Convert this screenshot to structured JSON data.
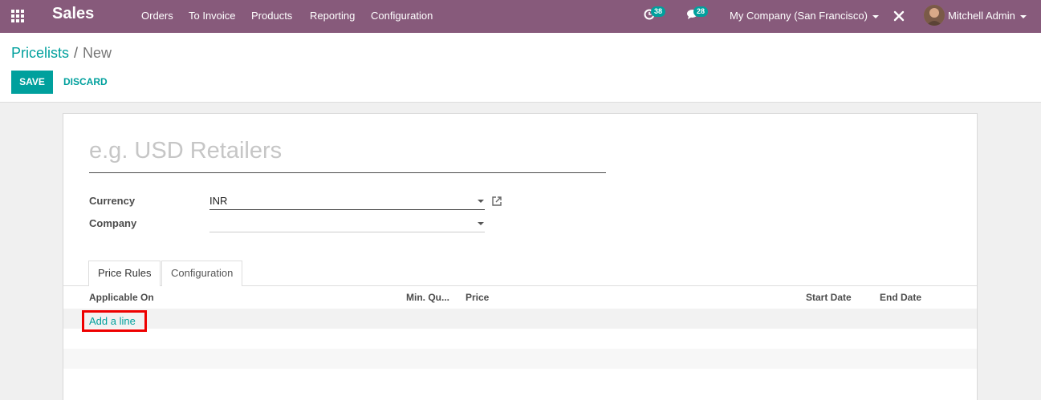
{
  "navbar": {
    "app_name": "Sales",
    "menu": [
      "Orders",
      "To Invoice",
      "Products",
      "Reporting",
      "Configuration"
    ],
    "activity_count": "38",
    "messages_count": "28",
    "company": "My Company (San Francisco)",
    "user": "Mitchell Admin"
  },
  "breadcrumb": {
    "parent": "Pricelists",
    "separator": "/",
    "current": "New"
  },
  "actions": {
    "save_label": "SAVE",
    "discard_label": "DISCARD"
  },
  "form": {
    "name_placeholder": "e.g. USD Retailers",
    "currency_label": "Currency",
    "currency_value": "INR",
    "company_label": "Company",
    "company_value": ""
  },
  "tabs": [
    {
      "label": "Price Rules",
      "active": true
    },
    {
      "label": "Configuration",
      "active": false
    }
  ],
  "table": {
    "columns": [
      "Applicable On",
      "Min. Qu...",
      "Price",
      "Start Date",
      "End Date"
    ],
    "add_line_label": "Add a line"
  },
  "colors": {
    "navbar": "#875a7b",
    "accent": "#00a09d",
    "highlight": "#e00000"
  }
}
